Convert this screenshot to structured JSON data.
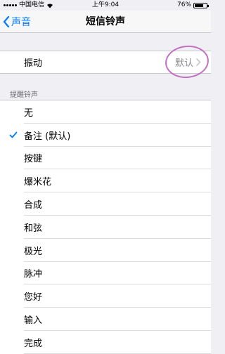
{
  "status_bar": {
    "carrier": "中国电信",
    "time": "上午9:04",
    "battery": "76%",
    "battery_level": 0.76
  },
  "nav": {
    "back_label": "声音",
    "title": "短信铃声"
  },
  "vibration": {
    "label": "振动",
    "value": "默认"
  },
  "section_header": "提醒铃声",
  "tones": [
    {
      "label": "无",
      "selected": false
    },
    {
      "label": "备注 (默认)",
      "selected": true
    },
    {
      "label": "按键",
      "selected": false
    },
    {
      "label": "爆米花",
      "selected": false
    },
    {
      "label": "合成",
      "selected": false
    },
    {
      "label": "和弦",
      "selected": false
    },
    {
      "label": "极光",
      "selected": false
    },
    {
      "label": "脉冲",
      "selected": false
    },
    {
      "label": "您好",
      "selected": false
    },
    {
      "label": "输入",
      "selected": false
    },
    {
      "label": "完成",
      "selected": false
    }
  ],
  "colors": {
    "accent": "#007aff",
    "highlight": "#c46fc4"
  }
}
